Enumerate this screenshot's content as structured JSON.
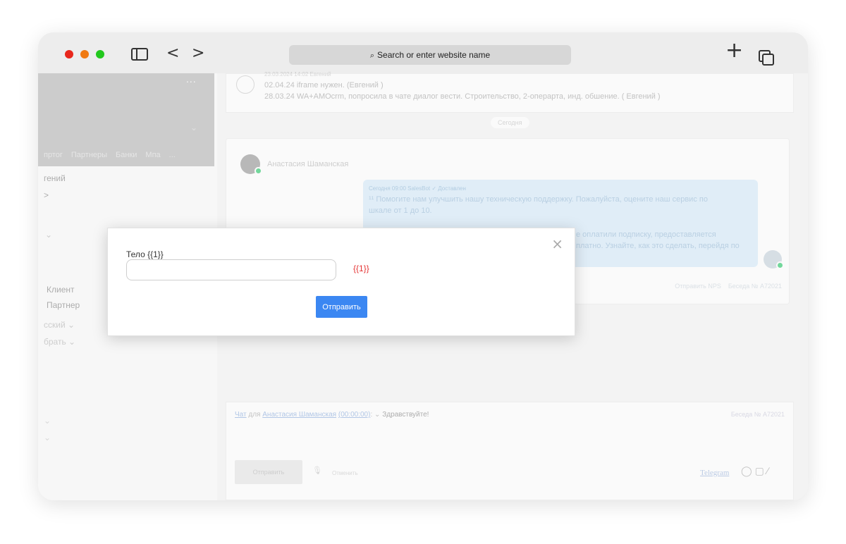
{
  "browser": {
    "url_placeholder": "Search or enter website name",
    "back_glyph": "<",
    "forward_glyph": ">",
    "newtab_glyph": "+"
  },
  "left_panel": {
    "dots": "...",
    "tabs": [
      "пртог",
      "Партнеры",
      "Банки",
      "Мпа",
      "..."
    ],
    "lines": [
      "гений",
      ">",
      "Клиент",
      "Партнер",
      "сский ⌄",
      "брать ⌄"
    ]
  },
  "conversation": {
    "notes": [
      "23.03.2024 14:02 Евгений",
      "02.04.24 iframe нужен. (Евгений )",
      "28.03.24 WA+AMOcrm, попросила в чате диалог вести. Строительство, 2-операрта, инд. обшение. ( Евгений )"
    ],
    "today_label": "Сегодня",
    "contact_name": "Анастасия Шаманская",
    "bubble_meta": "Сегодня 09:00 SalesBot ✓ Доставлен",
    "bubble_lines": [
      "¹¹ Помогите нам улучшить нашу техническую поддержку. Пожалуйста, оцените наш сервис по",
      "шкале от 1 до 10.",
      "е оплатили подписку, предоставляется",
      "платно. Узнайте, как это сделать, перейдя по"
    ],
    "footer_nps": "Отправить NPS",
    "footer_chat": "Беседа № А72021"
  },
  "composer": {
    "chat_link": "Чат",
    "for_label": "для",
    "contact_link": "Анастасия Шаманская",
    "time_link": "(00:00:00)",
    "greeting": "Здравствуйте!",
    "chat_ref": "Беседа № А72021",
    "send_label": "Отправить",
    "cancel_label": "Отменить",
    "telegram_link": "Telegram"
  },
  "modal": {
    "body_label": "Тело {{1}}",
    "input_value": "",
    "variable_hint": "{{1}}",
    "send_label": "Отправить",
    "close_glyph": "×"
  }
}
